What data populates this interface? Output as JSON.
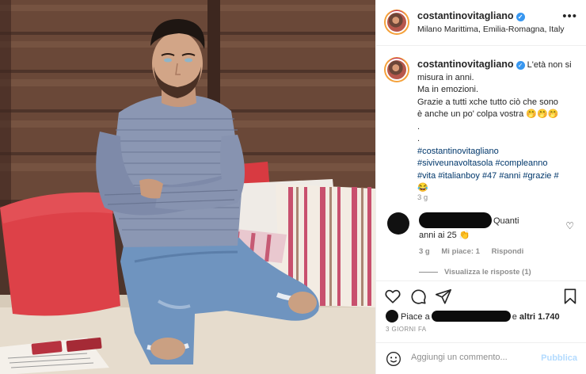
{
  "post": {
    "username": "costantinovitagliano",
    "location": "Milano Marittima, Emilia-Romagna, Italy",
    "more_icon": "more-horizontal-icon",
    "verified_glyph": "✓"
  },
  "caption": {
    "lines": [
      "L'età non si",
      "misura in anni.",
      "Ma in emozioni.",
      "Grazie a tutti xche tutto ciò che sono",
      "è anche un po' colpa vostra 🤭🤭🤭",
      ".",
      "."
    ],
    "hashtag_lines": [
      "#costantinovitagliano",
      "#siviveunavoltasola #compleanno",
      "#vita #italianboy #47 #anni #grazie #",
      "😂"
    ],
    "time": "3 g"
  },
  "comment": {
    "text_inline": "Quanti",
    "text_line2": "anni ai 25 👏",
    "time": "3 g",
    "likes": "Mi piace: 1",
    "reply": "Rispondi",
    "view_replies": "Visualizza le risposte (1)"
  },
  "actions": {
    "likes_prefix": "Piace a",
    "likes_suffix_plain": "e",
    "likes_suffix_bold": "altri 1.740",
    "time_ago": "3 GIORNI FA"
  },
  "add_comment": {
    "placeholder": "Aggiungi un commento...",
    "publish": "Pubblica"
  },
  "colors": {
    "accent_link": "#00376b",
    "publish_disabled": "#b3dbff",
    "verified": "#3897f0",
    "muted_text": "#8e8e8e"
  }
}
